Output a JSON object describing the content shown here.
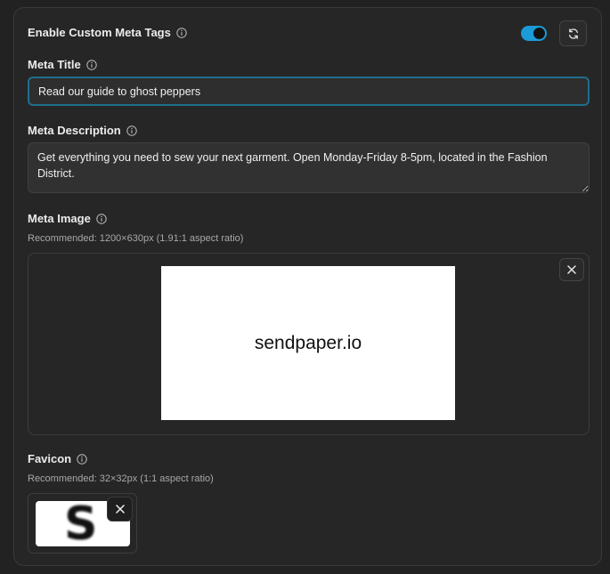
{
  "custom_meta": {
    "label": "Enable Custom Meta Tags",
    "enabled": true,
    "toggle_color": "#1b9bd8",
    "refresh_icon": "refresh-icon"
  },
  "meta_title": {
    "label": "Meta Title",
    "value": "Read our guide to ghost peppers"
  },
  "meta_description": {
    "label": "Meta Description",
    "value": "Get everything you need to sew your next garment. Open Monday-Friday 8-5pm, located in the Fashion District."
  },
  "meta_image": {
    "label": "Meta Image",
    "hint": "Recommended: 1200×630px (1.91:1 aspect ratio)",
    "preview_text": "sendpaper.io",
    "remove_icon": "close-icon"
  },
  "favicon": {
    "label": "Favicon",
    "hint": "Recommended: 32×32px (1:1 aspect ratio)",
    "preview_letter": "S",
    "remove_icon": "close-icon"
  }
}
